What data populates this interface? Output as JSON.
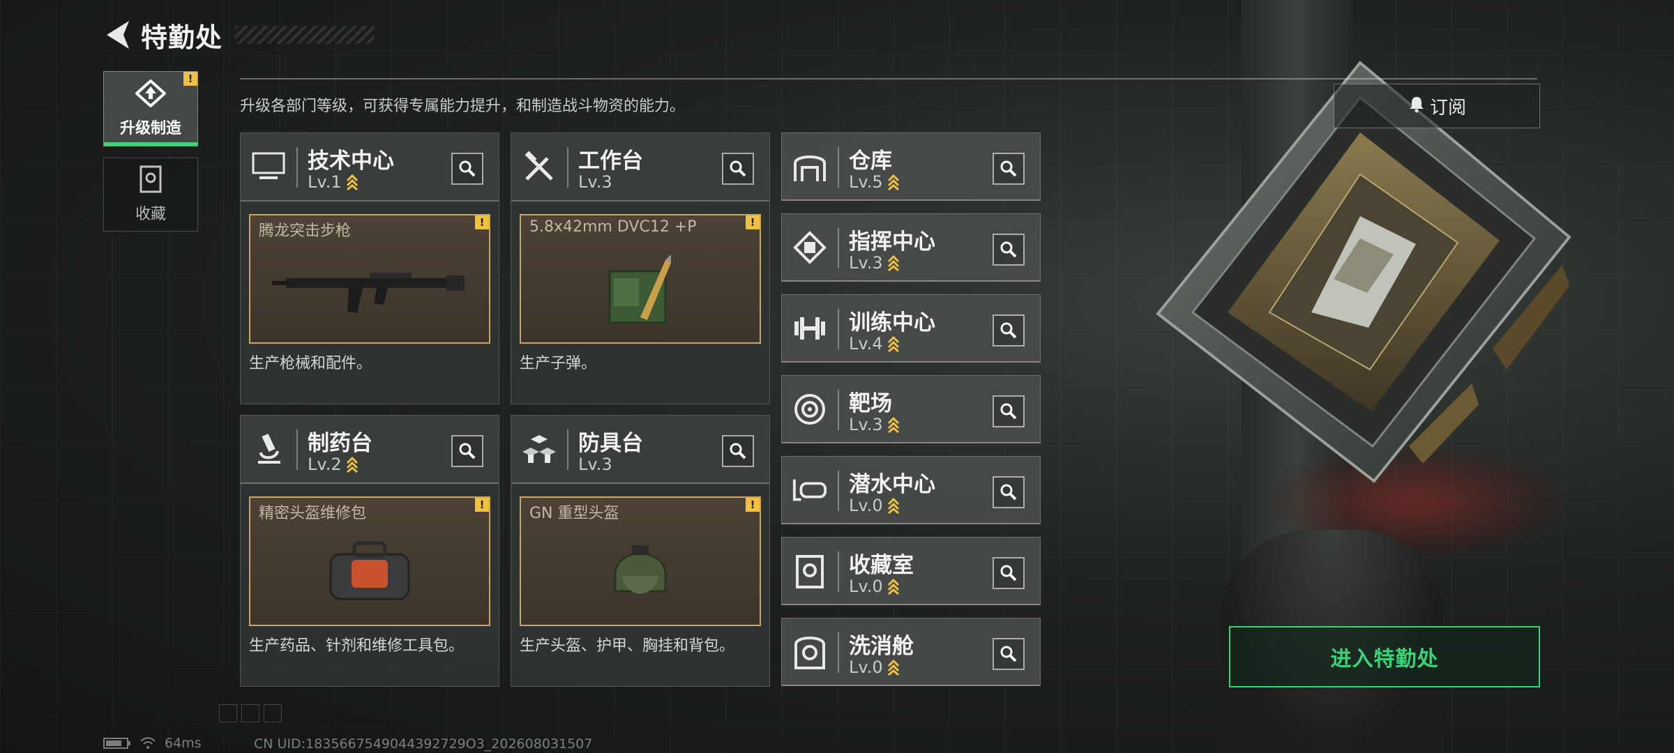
{
  "header": {
    "title": "特勤处"
  },
  "sidebar": {
    "items": [
      {
        "label": "升级制造",
        "active": true,
        "badge": "!"
      },
      {
        "label": "收藏",
        "active": false
      }
    ]
  },
  "description": "升级各部门等级，可获得专属能力提升，和制造战斗物资的能力。",
  "subscribe": {
    "label": "订阅"
  },
  "cards": [
    {
      "name": "技术中心",
      "level": "Lv.1",
      "upgradable": true,
      "icon": "monitor-icon",
      "product": "腾龙突击步枪",
      "product_art": "rifle-icon",
      "badge": "!",
      "desc": "生产枪械和配件。"
    },
    {
      "name": "工作台",
      "level": "Lv.3",
      "upgradable": false,
      "icon": "tools-icon",
      "product": "5.8x42mm DVC12 +P",
      "product_art": "ammo-box-icon",
      "badge": "!",
      "desc": "生产子弹。"
    },
    {
      "name": "制药台",
      "level": "Lv.2",
      "upgradable": true,
      "icon": "microscope-icon",
      "product": "精密头盔维修包",
      "product_art": "repair-bag-icon",
      "badge": "!",
      "desc": "生产药品、针剂和维修工具包。"
    },
    {
      "name": "防具台",
      "level": "Lv.3",
      "upgradable": false,
      "icon": "cubes-icon",
      "product": "GN 重型头盔",
      "product_art": "helmet-icon",
      "badge": "!",
      "desc": "生产头盔、护甲、胸挂和背包。"
    }
  ],
  "small_cards": [
    {
      "name": "仓库",
      "level": "Lv.5",
      "upgradable": true,
      "icon": "warehouse-icon"
    },
    {
      "name": "指挥中心",
      "level": "Lv.3",
      "upgradable": true,
      "icon": "chip-icon"
    },
    {
      "name": "训练中心",
      "level": "Lv.4",
      "upgradable": true,
      "icon": "dumbbell-icon"
    },
    {
      "name": "靶场",
      "level": "Lv.3",
      "upgradable": true,
      "icon": "target-icon"
    },
    {
      "name": "潜水中心",
      "level": "Lv.0",
      "upgradable": true,
      "icon": "diving-mask-icon"
    },
    {
      "name": "收藏室",
      "level": "Lv.0",
      "upgradable": true,
      "icon": "collection-icon"
    },
    {
      "name": "洗消舱",
      "level": "Lv.0",
      "upgradable": true,
      "icon": "decontam-icon"
    }
  ],
  "enter_button": {
    "label": "进入特勤处"
  },
  "footer": {
    "ping": "64ms",
    "uid": "CN UID:1835667549044392729O3_202608031507"
  },
  "colors": {
    "accent_green": "#39d37a",
    "warning_yellow": "#f0c040",
    "product_border": "#c9a760"
  }
}
